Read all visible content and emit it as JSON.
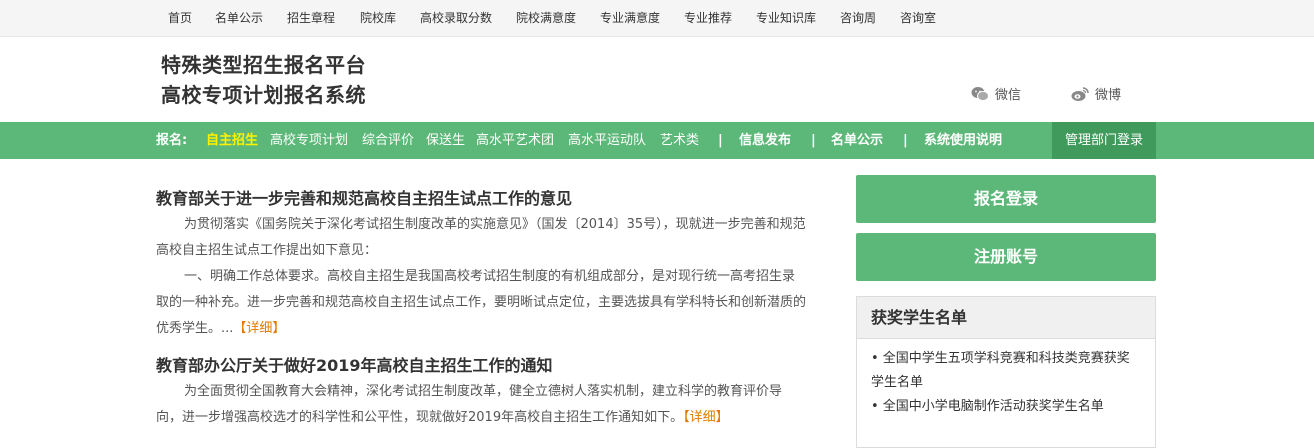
{
  "topnav": {
    "items": [
      "首页",
      "名单公示",
      "招生章程",
      "院校库",
      "高校录取分数",
      "院校满意度",
      "专业满意度",
      "专业推荐",
      "专业知识库",
      "咨询周",
      "咨询室"
    ]
  },
  "header": {
    "title_line1": "特殊类型招生报名平台",
    "title_line2": "高校专项计划报名系统",
    "wechat": "微信",
    "weibo": "微博"
  },
  "greenbar": {
    "prefix": "报名:",
    "active": "自主招生",
    "links": [
      "高校专项计划",
      "综合评价",
      "保送生",
      "高水平艺术团",
      "高水平运动队",
      "艺术类"
    ],
    "sep": "|",
    "info": "信息发布",
    "list": "名单公示",
    "manual": "系统使用说明",
    "admin": "管理部门登录"
  },
  "articles": [
    {
      "title": "教育部关于进一步完善和规范高校自主招生试点工作的意见",
      "p1": "为贯彻落实《国务院关于深化考试招生制度改革的实施意见》（国发〔2014〕35号），现就进一步完善和规范高校自主招生试点工作提出如下意见：",
      "p2": "一、明确工作总体要求。高校自主招生是我国高校考试招生制度的有机组成部分，是对现行统一高考招生录取的一种补充。进一步完善和规范高校自主招生试点工作，要明晰试点定位，主要选拔具有学科特长和创新潜质的优秀学生。...",
      "more": "【详细】"
    },
    {
      "title": "教育部办公厅关于做好2019年高校自主招生工作的通知",
      "p1": "为全面贯彻全国教育大会精神，深化考试招生制度改革，健全立德树人落实机制，建立科学的教育评价导向，进一步增强高校选才的科学性和公平性，现就做好2019年高校自主招生工作通知如下。",
      "more": "【详细】"
    }
  ],
  "sidebar": {
    "login": "报名登录",
    "register": "注册账号",
    "award_title": "获奖学生名单",
    "award_items": [
      "• 全国中学生五项学科竞赛和科技类竞赛获奖学生名单",
      "• 全国中小学电脑制作活动获奖学生名单"
    ]
  },
  "colors": {
    "green": "#5cb878",
    "dark_green": "#3f9a5c",
    "active_yellow": "#fff200",
    "detail_orange": "#e07b00"
  }
}
